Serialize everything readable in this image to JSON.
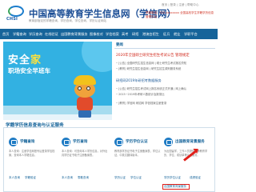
{
  "header": {
    "logo_text": "CHSI",
    "title": "中国高等教育学生信息网（学信网）",
    "subtitle": "教育部指定的学籍查询、学历查询、学位查询、学历认证网站",
    "top_links": "首页 | 登录 | 注册 | 帮助中心",
    "notice": "举报电话：010-xxxxxxxx   全国高校学生学籍学历信息管理平台"
  },
  "nav": {
    "items": [
      "首页",
      "学籍查询",
      "学历查询",
      "在线验证",
      "出国教育背景服务",
      "图像校对",
      "学信档案",
      "高考",
      "研招",
      "港澳台招生",
      "征兵",
      "就业",
      "学职平台"
    ]
  },
  "banner": {
    "word_a": "安全",
    "word_b": "家",
    "line2": "职场安全早班车"
  },
  "news": {
    "title": "要闻",
    "headline_1": "2020年全国硕士研究生招生考试公告 管理规定",
    "item_1": "[公告] 全国研究生招生信息网 | 硕士研究生考试报名须知",
    "item_2": "[教育] 研究生招生信息网 | 研究生招生调剂服务系统",
    "headline_2": "研招网2019年研招考数据服务",
    "item_3": "[公告] 研究生招生考试网上报名系统正式开通 | 网上确认",
    "item_4": "2015~2019年考研人数统计及报录比",
    "item_5": "[教育] 学信网 研招网 学信档案注册登录"
  },
  "services": {
    "title": "学籍学历信息查询与认证服务",
    "cards": [
      {
        "name": "学籍查询",
        "desc": "本人查询：注册学信网账号后登录学信档案，查询本人学籍信息。",
        "link_a": "本人查询",
        "link_b": "学籍验证"
      },
      {
        "name": "学历查询",
        "desc": "本人查询：可查询本人学历信息，对外出具学历证书电子注册备案表。",
        "link_a": "本人查询",
        "link_b": "零散查询"
      },
      {
        "name": "学历学位认证",
        "desc": "教育部学历证书电子注册备案表，学位认证，中英文翻译版本。",
        "link_a": "学历认证",
        "link_b": "学位认证"
      },
      {
        "name": "出国教育背景服务",
        "desc": "为出国留学、工作人员提供高等教育学历、学位、成绩单等认证服务。",
        "link_a": "学历学位认证",
        "link_b": "成绩验证",
        "link_c": "出国教育背景服务"
      }
    ]
  },
  "colors": {
    "brand": "#16649a",
    "banner": "#32b1e2",
    "alert": "#e0201a"
  }
}
